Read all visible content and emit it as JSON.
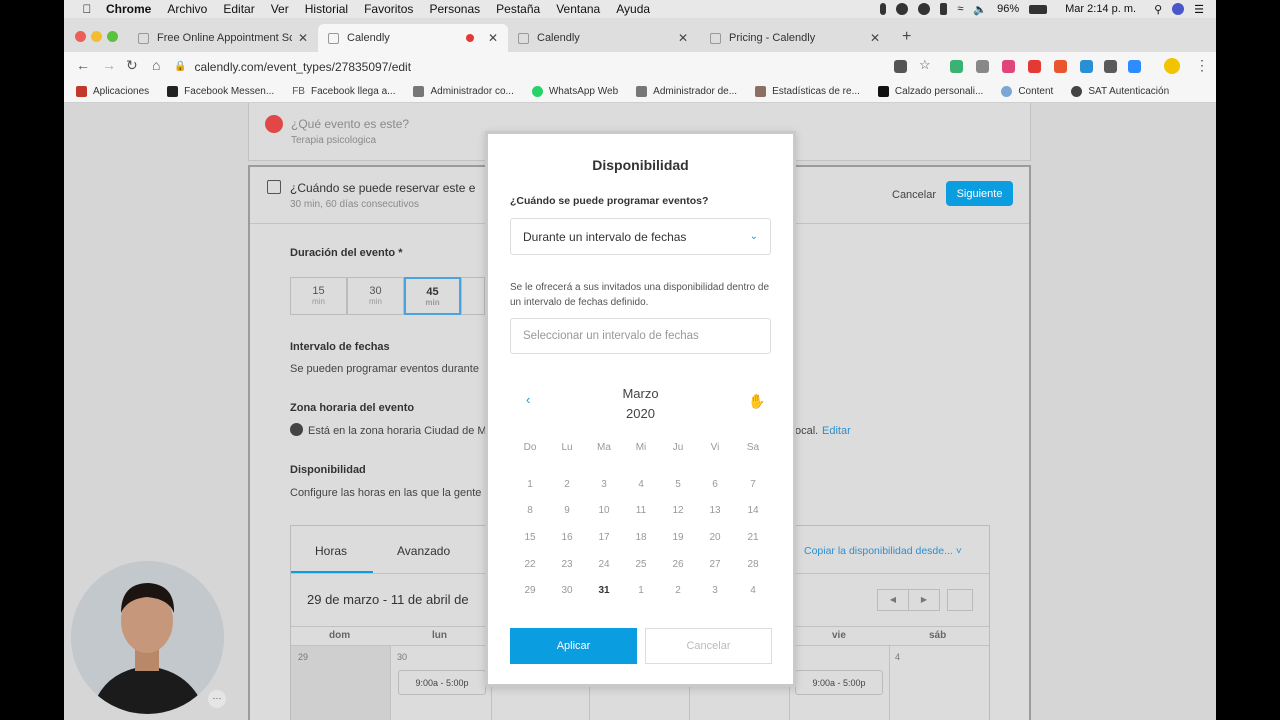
{
  "menubar": {
    "app": "Chrome",
    "items": [
      "Archivo",
      "Editar",
      "Ver",
      "Historial",
      "Favoritos",
      "Personas",
      "Pestaña",
      "Ventana",
      "Ayuda"
    ],
    "battery": "96%",
    "clock": "Mar 2:14 p. m."
  },
  "tabs": [
    {
      "title": "Free Online Appointment Sche"
    },
    {
      "title": "Calendly"
    },
    {
      "title": "Calendly"
    },
    {
      "title": "Pricing - Calendly"
    }
  ],
  "address": {
    "url": "calendly.com/event_types/27835097/edit"
  },
  "bookmarks": [
    "Aplicaciones",
    "Facebook Messen...",
    "Facebook llega a...",
    "Administrador co...",
    "WhatsApp Web",
    "Administrador de...",
    "Estadísticas de re...",
    "Calzado personali...",
    "Content",
    "SAT Autenticación"
  ],
  "bookmark_fb_prefix": "FB",
  "page": {
    "what_title": "¿Qué evento es este?",
    "what_sub": "Terapia psicologica",
    "when_title": "¿Cuándo se puede reservar este e",
    "when_sub": "30 min, 60 días consecutivos",
    "cancel": "Cancelar",
    "next": "Siguiente",
    "duration_label": "Duración del evento *",
    "durations": [
      {
        "value": "15",
        "unit": "min"
      },
      {
        "value": "30",
        "unit": "min"
      },
      {
        "value": "45",
        "unit": "min"
      }
    ],
    "date_range_label": "Intervalo de fechas",
    "date_range_text": "Se pueden programar eventos durante",
    "tz_label": "Zona horaria del evento",
    "tz_text": "Está en la zona horaria Ciudad de M",
    "tz_tail": "ocal.",
    "tz_edit": "Editar",
    "avail_label": "Disponibilidad",
    "avail_text": "Configure las horas en las que la gente",
    "tab_hours": "Horas",
    "tab_advanced": "Avanzado",
    "copy_link": "Copiar la disponibilidad desde...",
    "week_range": "29 de marzo - 11 de abril de",
    "days": [
      "dom",
      "lun",
      "vie",
      "sáb"
    ],
    "dates": [
      "29",
      "30",
      "4"
    ],
    "slot": "9:00a - 5:00p"
  },
  "modal": {
    "title": "Disponibilidad",
    "question": "¿Cuándo se puede programar eventos?",
    "select_value": "Durante un intervalo de fechas",
    "description": "Se le ofrecerá a sus invitados una disponibilidad dentro de un intervalo de fechas definido.",
    "range_placeholder": "Seleccionar un intervalo de fechas",
    "month": "Marzo",
    "year": "2020",
    "weekdays": [
      "Do",
      "Lu",
      "Ma",
      "Mi",
      "Ju",
      "Vi",
      "Sa"
    ],
    "weeks": [
      [
        "1",
        "2",
        "3",
        "4",
        "5",
        "6",
        "7"
      ],
      [
        "8",
        "9",
        "10",
        "11",
        "12",
        "13",
        "14"
      ],
      [
        "15",
        "16",
        "17",
        "18",
        "19",
        "20",
        "21"
      ],
      [
        "22",
        "23",
        "24",
        "25",
        "26",
        "27",
        "28"
      ],
      [
        "29",
        "30",
        "31",
        "1",
        "2",
        "3",
        "4"
      ]
    ],
    "today": "31",
    "apply": "Aplicar",
    "cancel": "Cancelar"
  },
  "colors": {
    "accent": "#0a9de0",
    "record": "#e53935"
  }
}
